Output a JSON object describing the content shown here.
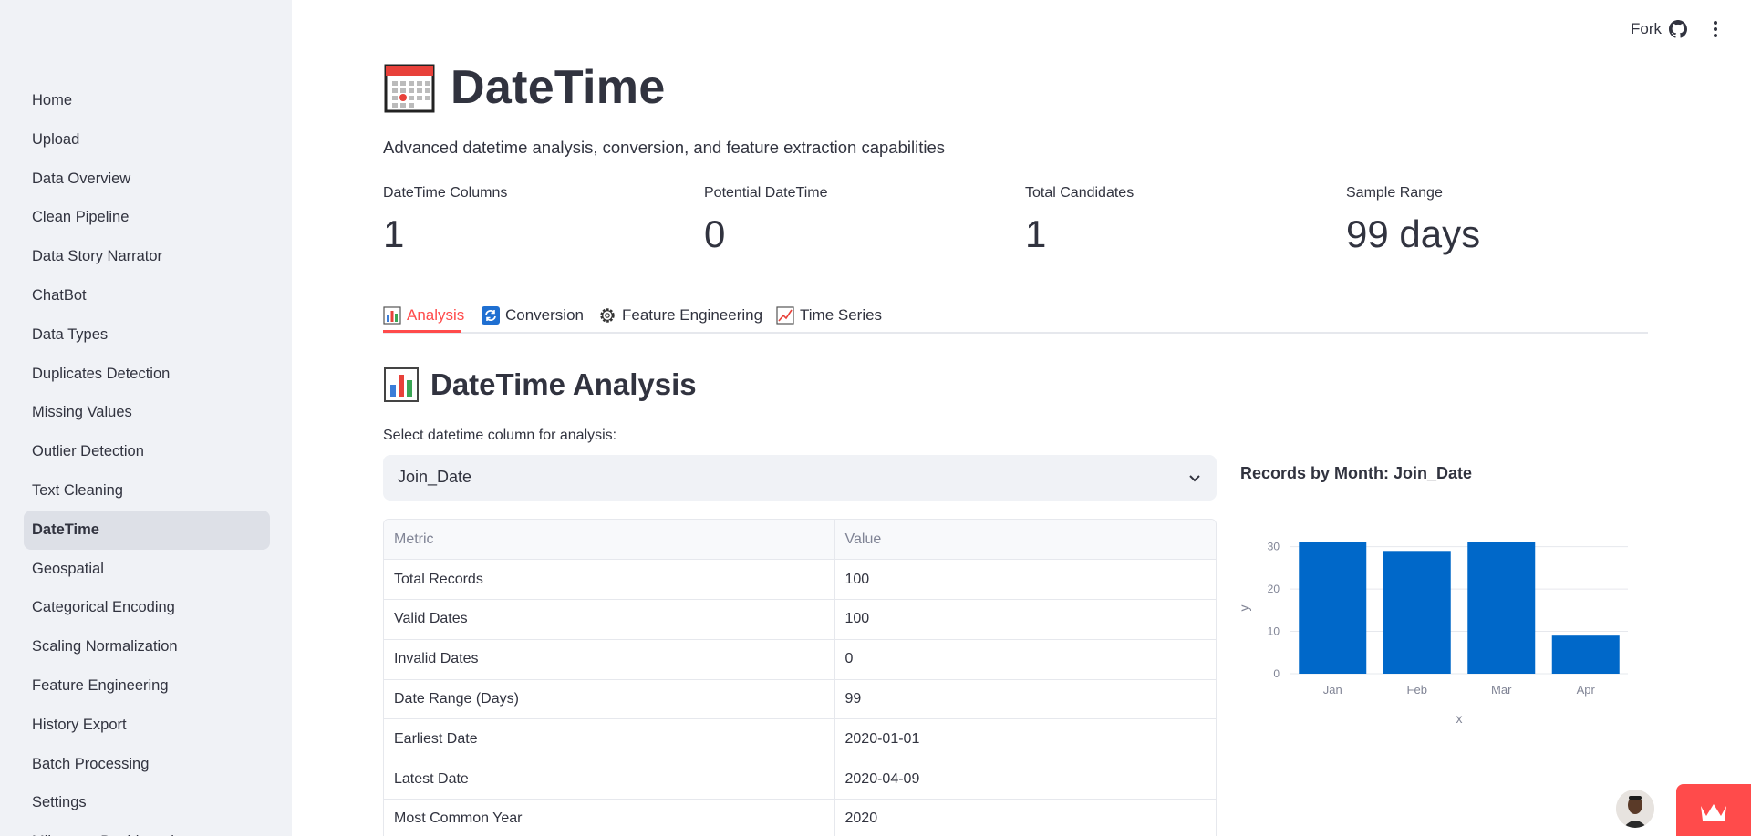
{
  "header": {
    "fork_label": "Fork"
  },
  "sidebar": {
    "items": [
      {
        "label": "Home"
      },
      {
        "label": "Upload"
      },
      {
        "label": "Data Overview"
      },
      {
        "label": "Clean Pipeline"
      },
      {
        "label": "Data Story Narrator"
      },
      {
        "label": "ChatBot"
      },
      {
        "label": "Data Types"
      },
      {
        "label": "Duplicates Detection"
      },
      {
        "label": "Missing Values"
      },
      {
        "label": "Outlier Detection"
      },
      {
        "label": "Text Cleaning"
      },
      {
        "label": "DateTime",
        "active": true
      },
      {
        "label": "Geospatial"
      },
      {
        "label": "Categorical Encoding"
      },
      {
        "label": "Scaling Normalization"
      },
      {
        "label": "Feature Engineering"
      },
      {
        "label": "History Export"
      },
      {
        "label": "Batch Processing"
      },
      {
        "label": "Settings"
      },
      {
        "label": "Milestone Dashboard"
      }
    ]
  },
  "page": {
    "title": "DateTime",
    "subtitle": "Advanced datetime analysis, conversion, and feature extraction capabilities"
  },
  "metrics": [
    {
      "label": "DateTime Columns",
      "value": "1"
    },
    {
      "label": "Potential DateTime",
      "value": "0"
    },
    {
      "label": "Total Candidates",
      "value": "1"
    },
    {
      "label": "Sample Range",
      "value": "99 days"
    }
  ],
  "tabs": [
    {
      "label": "Analysis",
      "icon": "bar-chart-icon",
      "active": true
    },
    {
      "label": "Conversion",
      "icon": "refresh-icon"
    },
    {
      "label": "Feature Engineering",
      "icon": "gear-icon"
    },
    {
      "label": "Time Series",
      "icon": "line-chart-icon"
    }
  ],
  "section": {
    "title": "DateTime Analysis",
    "select_label": "Select datetime column for analysis:",
    "select_value": "Join_Date"
  },
  "table": {
    "headers": [
      "Metric",
      "Value"
    ],
    "rows": [
      [
        "Total Records",
        "100"
      ],
      [
        "Valid Dates",
        "100"
      ],
      [
        "Invalid Dates",
        "0"
      ],
      [
        "Date Range (Days)",
        "99"
      ],
      [
        "Earliest Date",
        "2020-01-01"
      ],
      [
        "Latest Date",
        "2020-04-09"
      ],
      [
        "Most Common Year",
        "2020"
      ]
    ]
  },
  "chart_data": {
    "type": "bar",
    "title": "Records by Month: Join_Date",
    "categories": [
      "Jan",
      "Feb",
      "Mar",
      "Apr"
    ],
    "values": [
      31,
      29,
      31,
      9
    ],
    "xlabel": "x",
    "ylabel": "y",
    "ylim": [
      0,
      31
    ],
    "yticks": [
      0,
      10,
      20,
      30
    ],
    "grid": true,
    "bar_color": "#0068c9"
  },
  "colors": {
    "accent": "#ff4b4b",
    "sidebar_bg": "#f0f2f6",
    "bar": "#0068c9"
  }
}
